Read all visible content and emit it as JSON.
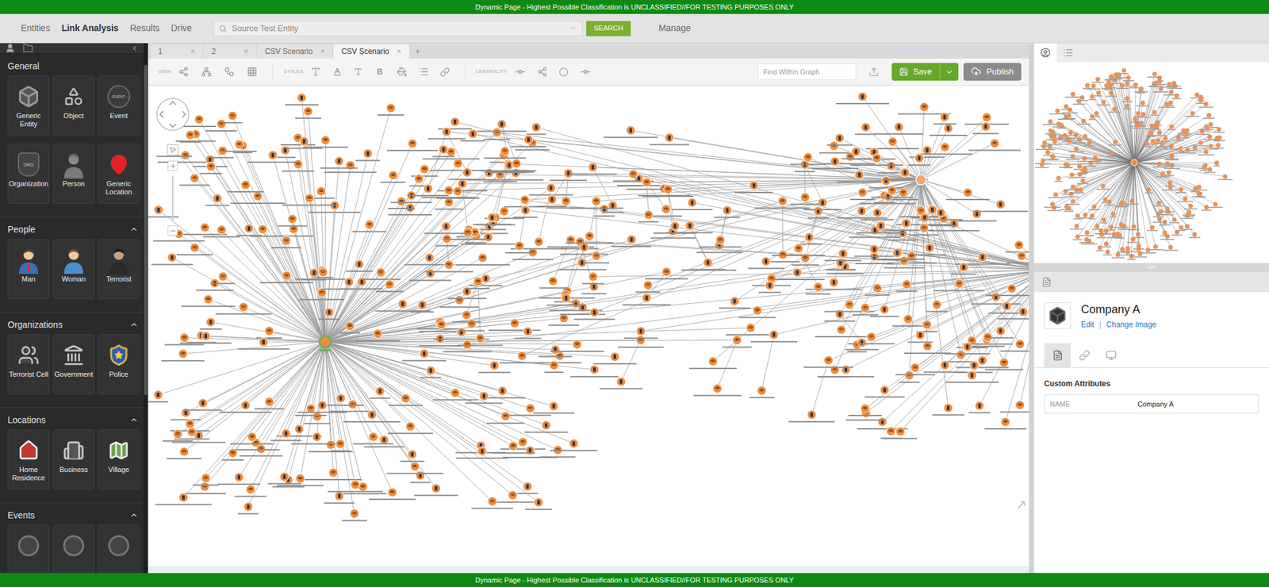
{
  "banner": "Dynamic Page - Highest Possible Classification is UNCLASSIFIED//FOR TESTING PURPOSES ONLY",
  "nav": [
    {
      "label": "Entities",
      "selected": false
    },
    {
      "label": "Link Analysis",
      "selected": true
    },
    {
      "label": "Results",
      "selected": false
    },
    {
      "label": "Drive",
      "selected": false
    }
  ],
  "search": {
    "value": "Source Test Entity",
    "button": "SEARCH"
  },
  "manage": "Manage",
  "sidebar": {
    "sections": [
      {
        "title": "General",
        "collapsible": false,
        "items": [
          {
            "label": "Generic Entity"
          },
          {
            "label": "Object"
          },
          {
            "label": "Event",
            "badge": "EVENT"
          },
          {
            "label": "Organization",
            "badge": "ORG"
          },
          {
            "label": "Person"
          },
          {
            "label": "Generic Location"
          }
        ]
      },
      {
        "title": "People",
        "collapsible": true,
        "items": [
          {
            "label": "Man"
          },
          {
            "label": "Woman"
          },
          {
            "label": "Terrorist"
          }
        ]
      },
      {
        "title": "Organizations",
        "collapsible": true,
        "items": [
          {
            "label": "Terrorist Cell"
          },
          {
            "label": "Government"
          },
          {
            "label": "Police"
          }
        ]
      },
      {
        "title": "Locations",
        "collapsible": true,
        "items": [
          {
            "label": "Home Residence"
          },
          {
            "label": "Business"
          },
          {
            "label": "Village"
          }
        ]
      },
      {
        "title": "Events",
        "collapsible": true,
        "items": [
          {
            "label": ""
          },
          {
            "label": ""
          },
          {
            "label": ""
          }
        ]
      }
    ]
  },
  "tabs": {
    "close_glyph": "×",
    "add": "+",
    "items": [
      {
        "label": "1",
        "selected": false
      },
      {
        "label": "2",
        "selected": false
      },
      {
        "label": "CSV Scenario",
        "selected": false
      },
      {
        "label": "CSV Scenario",
        "selected": true
      }
    ]
  },
  "toolbar": {
    "groups": [
      "VIEW",
      "STYLES",
      "CENTRALITY"
    ],
    "bold_button": "B",
    "find_placeholder": "Find Within Graph",
    "save": "Save",
    "publish": "Publish"
  },
  "overview_tabs": [
    {
      "selected": true
    },
    {
      "selected": false
    }
  ],
  "details": {
    "title": "Company A",
    "actions": [
      "Edit",
      "Change Image"
    ],
    "separator": "|",
    "tabs": [
      {
        "selected": true
      },
      {
        "selected": false
      },
      {
        "selected": false
      }
    ],
    "section": "Custom Attributes",
    "attributes": [
      {
        "name": "NAME",
        "value": "Company A"
      }
    ]
  }
}
